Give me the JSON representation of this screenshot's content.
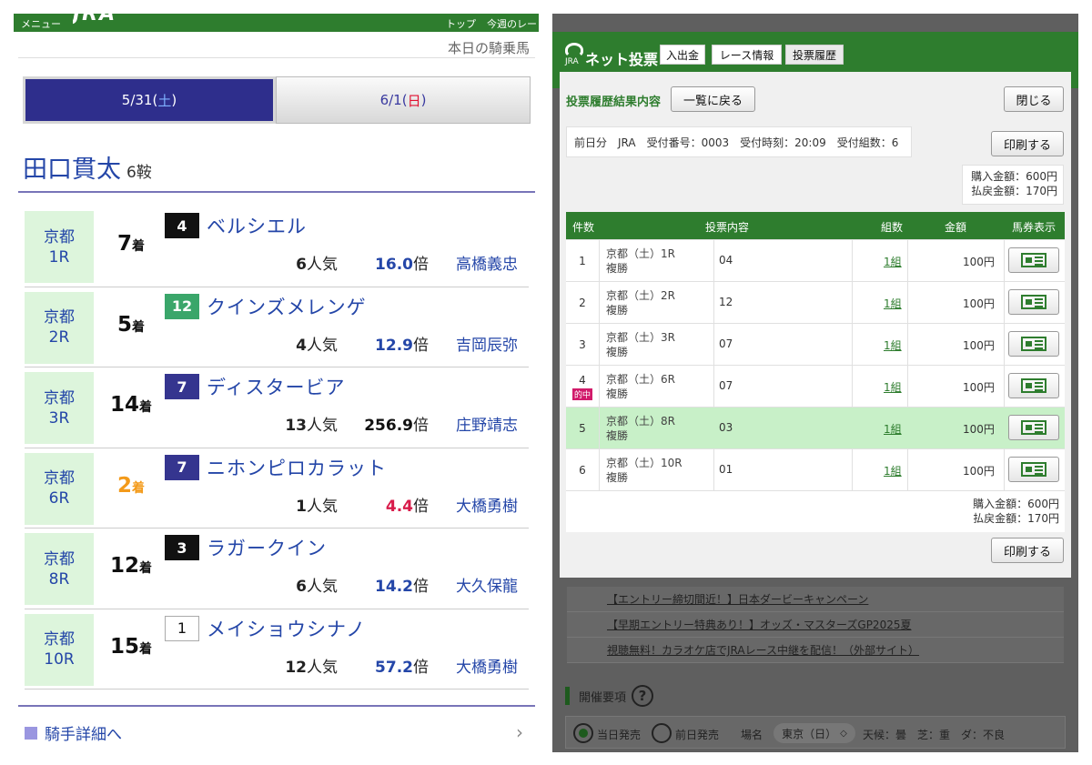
{
  "left": {
    "topbar": {
      "menu": "メニュー",
      "logo": "JRA",
      "top": "トップ",
      "this_week": "今週のレース"
    },
    "subtitle": "本日の騎乗馬",
    "date_tabs": [
      {
        "date": "5/31(",
        "dow": "土",
        "close": ")"
      },
      {
        "date": "6/1(",
        "dow": "日",
        "close": ")"
      }
    ],
    "jockey": {
      "name": "田口貫太",
      "rides": "6鞍"
    },
    "races": [
      {
        "venue": "京都",
        "race": "1R",
        "place": "7",
        "chaku": "着",
        "gate": "4",
        "horse": "ベルシエル",
        "pop": "6",
        "pop_unit": "人気",
        "odds": "16.0",
        "odds_unit": "倍",
        "trainer": "高橋義忠"
      },
      {
        "venue": "京都",
        "race": "2R",
        "place": "5",
        "chaku": "着",
        "gate": "12",
        "horse": "クインズメレンゲ",
        "pop": "4",
        "pop_unit": "人気",
        "odds": "12.9",
        "odds_unit": "倍",
        "trainer": "吉岡辰弥"
      },
      {
        "venue": "京都",
        "race": "3R",
        "place": "14",
        "chaku": "着",
        "gate": "7",
        "horse": "ディスタービア",
        "pop": "13",
        "pop_unit": "人気",
        "odds": "256.9",
        "odds_unit": "倍",
        "trainer": "庄野靖志"
      },
      {
        "venue": "京都",
        "race": "6R",
        "place": "2",
        "chaku": "着",
        "gate": "7",
        "horse": "ニホンピロカラット",
        "pop": "1",
        "pop_unit": "人気",
        "odds": "4.4",
        "odds_unit": "倍",
        "trainer": "大橋勇樹"
      },
      {
        "venue": "京都",
        "race": "8R",
        "place": "12",
        "chaku": "着",
        "gate": "3",
        "horse": "ラガークイン",
        "pop": "6",
        "pop_unit": "人気",
        "odds": "14.2",
        "odds_unit": "倍",
        "trainer": "大久保龍"
      },
      {
        "venue": "京都",
        "race": "10R",
        "place": "15",
        "chaku": "着",
        "gate": "1",
        "horse": "メイショウシナノ",
        "pop": "12",
        "pop_unit": "人気",
        "odds": "57.2",
        "odds_unit": "倍",
        "trainer": "大橋勇樹"
      }
    ],
    "detail_link": "騎手詳細へ",
    "arrow": "›"
  },
  "right": {
    "header": {
      "logo_text": "JRA",
      "title": "ネット投票",
      "tabs": [
        "入出金",
        "レース情報",
        "投票履歴"
      ]
    },
    "modal": {
      "title": "投票履歴結果内容",
      "back": "一覧に戻る",
      "close": "閉じる",
      "info": "前日分　JRA　受付番号：0003　受付時刻：20:09　受付組数：6",
      "print": "印刷する",
      "buy": "購入金額：600円",
      "refund": "払戻金額：170円",
      "columns": [
        "件数",
        "投票内容",
        "組数",
        "金額",
        "馬券表示"
      ],
      "rows": [
        {
          "no": "1",
          "race": "京都（土）1R",
          "type": "複勝",
          "sel": "04",
          "kumi": "1組",
          "amount": "100円",
          "hit": ""
        },
        {
          "no": "2",
          "race": "京都（土）2R",
          "type": "複勝",
          "sel": "12",
          "kumi": "1組",
          "amount": "100円",
          "hit": ""
        },
        {
          "no": "3",
          "race": "京都（土）3R",
          "type": "複勝",
          "sel": "07",
          "kumi": "1組",
          "amount": "100円",
          "hit": ""
        },
        {
          "no": "4",
          "race": "京都（土）6R",
          "type": "複勝",
          "sel": "07",
          "kumi": "1組",
          "amount": "100円",
          "hit": "的中"
        },
        {
          "no": "5",
          "race": "京都（土）8R",
          "type": "複勝",
          "sel": "03",
          "kumi": "1組",
          "amount": "100円",
          "hit": ""
        },
        {
          "no": "6",
          "race": "京都（土）10R",
          "type": "複勝",
          "sel": "01",
          "kumi": "1組",
          "amount": "100円",
          "hit": ""
        }
      ]
    },
    "promos": [
      "【エントリー締切間近！】日本ダービーキャンペーン",
      "【早期エントリー特典あり！】オッズ・マスターズGP2025夏",
      "視聴無料！カラオケ店でJRAレース中継を配信！（外部サイト）"
    ],
    "kaisai": {
      "label": "開催要項",
      "help": "?"
    },
    "sale": {
      "today": "当日発売",
      "prev": "前日発売",
      "place_label": "場名",
      "place": "東京（日）",
      "chevron": "◇",
      "weather": "天候：曇　芝：重　ダ：不良"
    }
  },
  "colors": {
    "jra_green": "#2e7d2e",
    "link_blue": "#2446a8",
    "active_tab": "#2e2e8c",
    "hit_pink": "#d11a6a",
    "placed_orange": "#f39a1a"
  }
}
